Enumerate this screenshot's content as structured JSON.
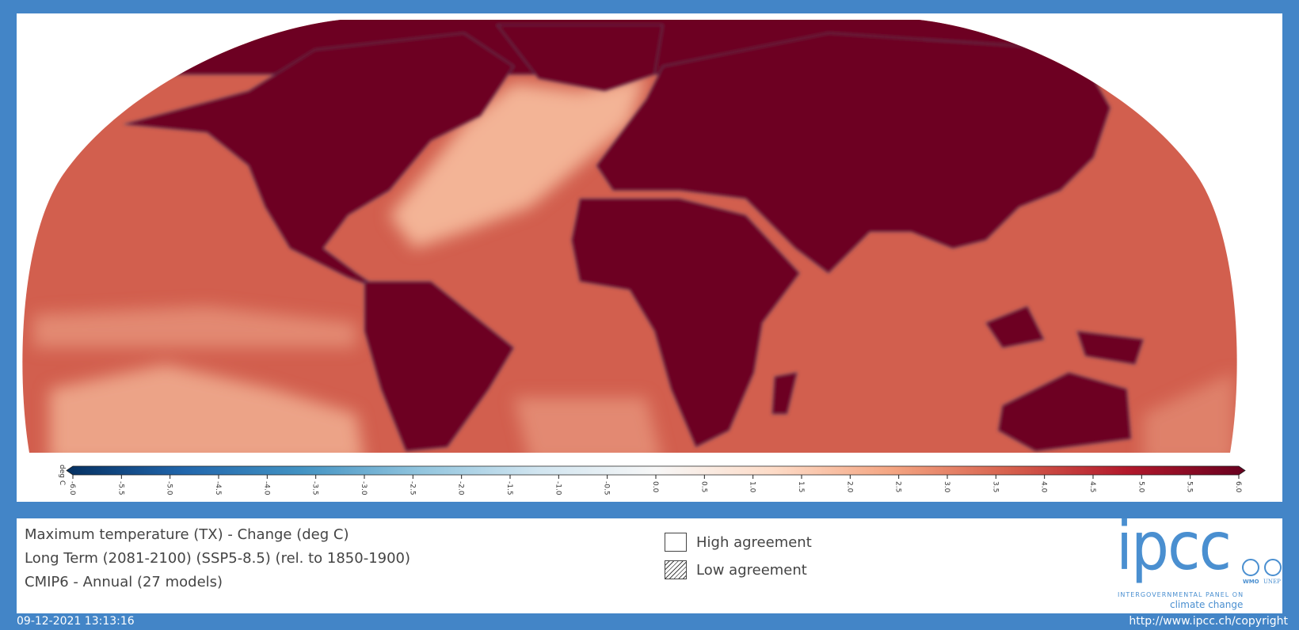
{
  "map": {
    "colorbar": {
      "label": "deg C",
      "min": -6.0,
      "max": 6.0,
      "extend": "both",
      "colormap": "RdBu_r",
      "ticks": [
        "-6.0",
        "-5.5",
        "-5.0",
        "-4.5",
        "-4.0",
        "-3.5",
        "-3.0",
        "-2.5",
        "-2.0",
        "-1.5",
        "-1.0",
        "-0.5",
        "0.0",
        "0.5",
        "1.0",
        "1.5",
        "2.0",
        "2.5",
        "3.0",
        "3.5",
        "4.0",
        "4.5",
        "5.0",
        "5.5",
        "6.0"
      ],
      "colors": [
        "#053061",
        "#2166ac",
        "#4393c3",
        "#92c5de",
        "#d1e5f0",
        "#f7f7f7",
        "#fddbc7",
        "#f4a582",
        "#d6604d",
        "#b2182b",
        "#67001f"
      ]
    },
    "colors": {
      "land": "#6d0021",
      "ocean": "#d25f4e",
      "ocean_light": "#f3b496",
      "coast": "#3a4f7a"
    }
  },
  "info": {
    "line1": "Maximum temperature (TX) - Change (deg C)",
    "line2": "Long Term (2081-2100) (SSP5-8.5) (rel. to 1850-1900)",
    "line3": "CMIP6 - Annual (27 models)"
  },
  "legend": {
    "high": "High agreement",
    "low": "Low agreement"
  },
  "logo": {
    "name": "ipcc",
    "tagline1": "INTERGOVERNMENTAL PANEL ON",
    "tagline2": "climate change",
    "partner1": "WMO",
    "partner2": "UNEP"
  },
  "footer": {
    "timestamp": "09-12-2021 13:13:16",
    "copyright": "http://www.ipcc.ch/copyright"
  }
}
